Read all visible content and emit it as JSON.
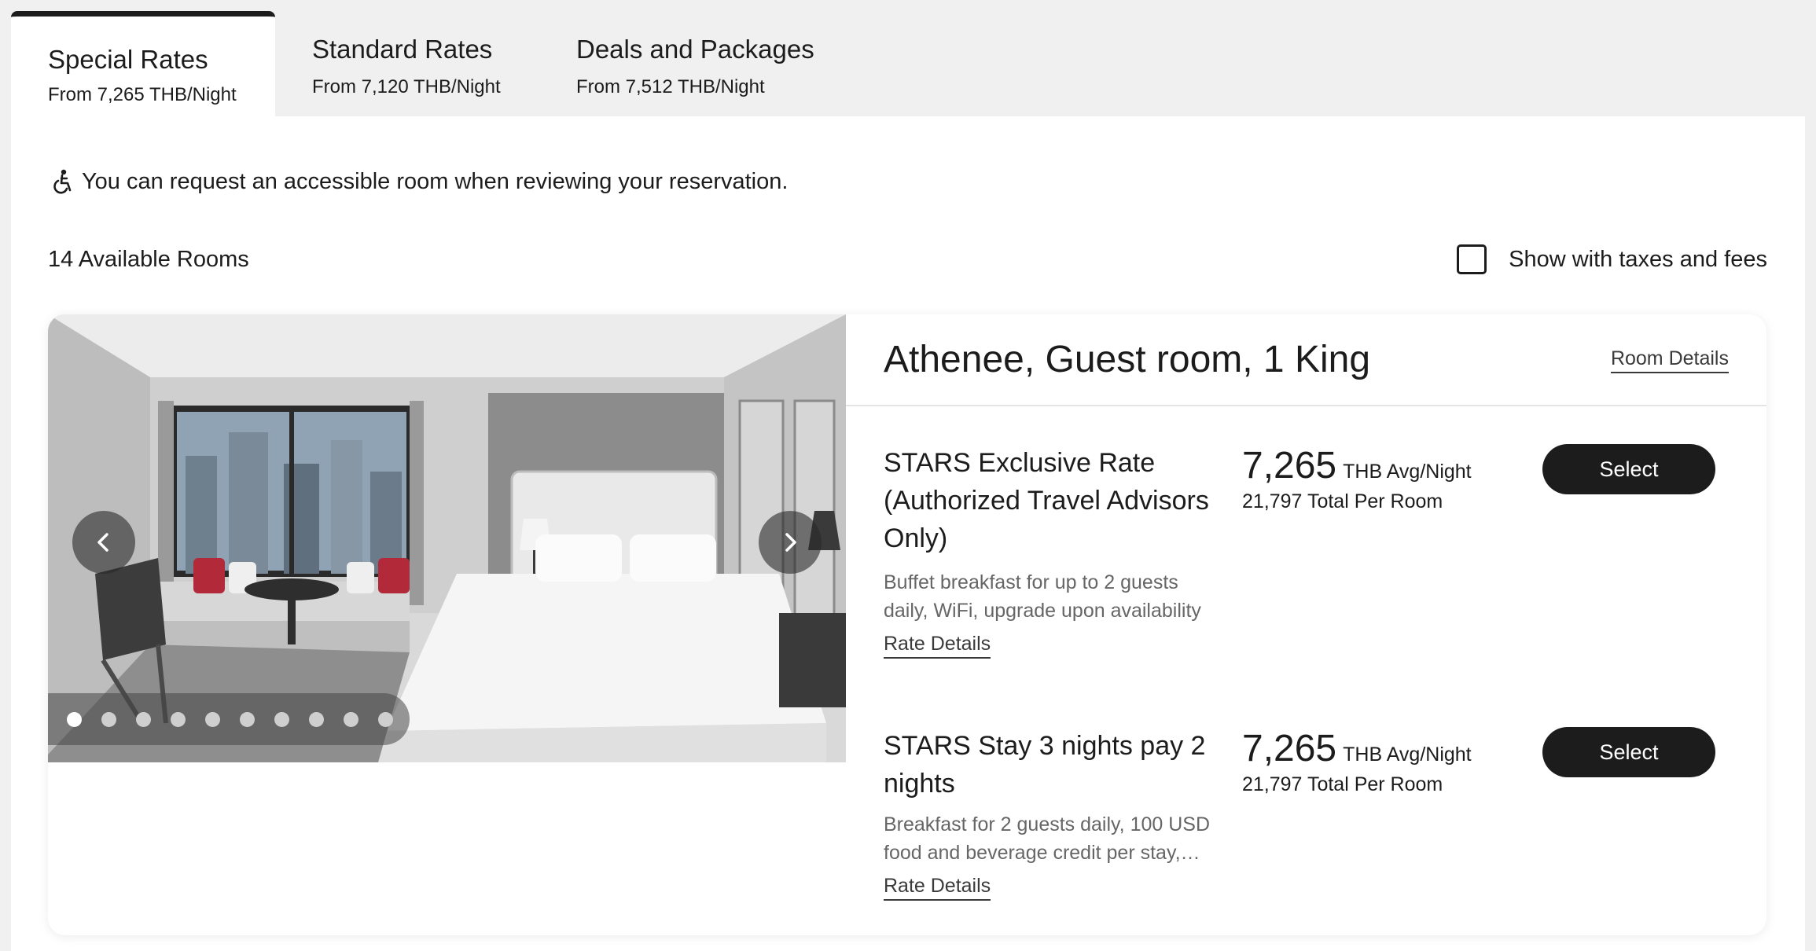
{
  "tabs": [
    {
      "title": "Special Rates",
      "sub": "From 7,265 THB/Night",
      "active": true
    },
    {
      "title": "Standard Rates",
      "sub": "From 7,120 THB/Night",
      "active": false
    },
    {
      "title": "Deals and Packages",
      "sub": "From 7,512 THB/Night",
      "active": false
    }
  ],
  "notice": {
    "icon": "accessibility-icon",
    "text": "You can request an accessible room when reviewing your reservation."
  },
  "rooms_count": "14 Available Rooms",
  "taxes_toggle": {
    "label": "Show with taxes and fees",
    "checked": false
  },
  "room": {
    "title": "Athenee, Guest room, 1 King",
    "details_link": "Room Details",
    "photo_dots": 10,
    "active_dot": 0,
    "rates": [
      {
        "name": "STARS Exclusive Rate (Authorized Travel Advisors Only)",
        "desc": "Buffet breakfast for up to 2 guests daily, WiFi, upgrade upon availability …",
        "link": "Rate Details",
        "amount": "7,265",
        "unit": "THB Avg/Night",
        "total": "21,797 Total Per Room",
        "button": "Select"
      },
      {
        "name": "STARS Stay 3 nights pay 2 nights",
        "desc": "Breakfast for 2 guests daily, 100 USD food and beverage credit per stay,…",
        "link": "Rate Details",
        "amount": "7,265",
        "unit": "THB Avg/Night",
        "total": "21,797 Total Per Room",
        "button": "Select"
      }
    ]
  },
  "colors": {
    "primary": "#1c1c1c",
    "background": "#f0f0f0",
    "muted_text": "#666666"
  }
}
